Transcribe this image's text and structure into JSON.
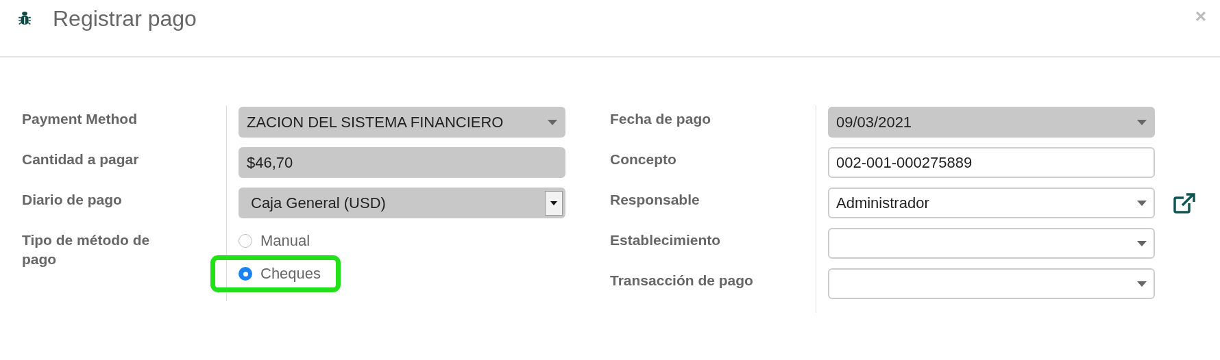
{
  "dialog": {
    "title": "Registrar pago",
    "close": "×"
  },
  "left_fields": [
    {
      "label": "Payment Method",
      "kind": "select",
      "readonly": true,
      "value": "ZACION DEL SISTEMA FINANCIERO"
    },
    {
      "label": "Cantidad a pagar",
      "kind": "input",
      "readonly": true,
      "value": "$46,70"
    },
    {
      "label": "Diario de pago",
      "kind": "native-select",
      "readonly": true,
      "value": "Caja General (USD)"
    },
    {
      "label": "Tipo de método de pago",
      "kind": "radio",
      "options": [
        {
          "label": "Manual",
          "selected": false,
          "highlighted": false
        },
        {
          "label": "Cheques",
          "selected": true,
          "highlighted": true
        }
      ]
    }
  ],
  "right_fields": [
    {
      "label": "Fecha de pago",
      "kind": "select",
      "readonly": true,
      "value": "09/03/2021",
      "link": false
    },
    {
      "label": "Concepto",
      "kind": "input",
      "readonly": false,
      "value": "002-001-000275889",
      "link": false
    },
    {
      "label": "Responsable",
      "kind": "select",
      "readonly": false,
      "value": "Administrador",
      "link": true
    },
    {
      "label": "Establecimiento",
      "kind": "select",
      "readonly": false,
      "link": false
    },
    {
      "label": "Transacción de pago",
      "kind": "select",
      "readonly": false,
      "link": false
    }
  ]
}
